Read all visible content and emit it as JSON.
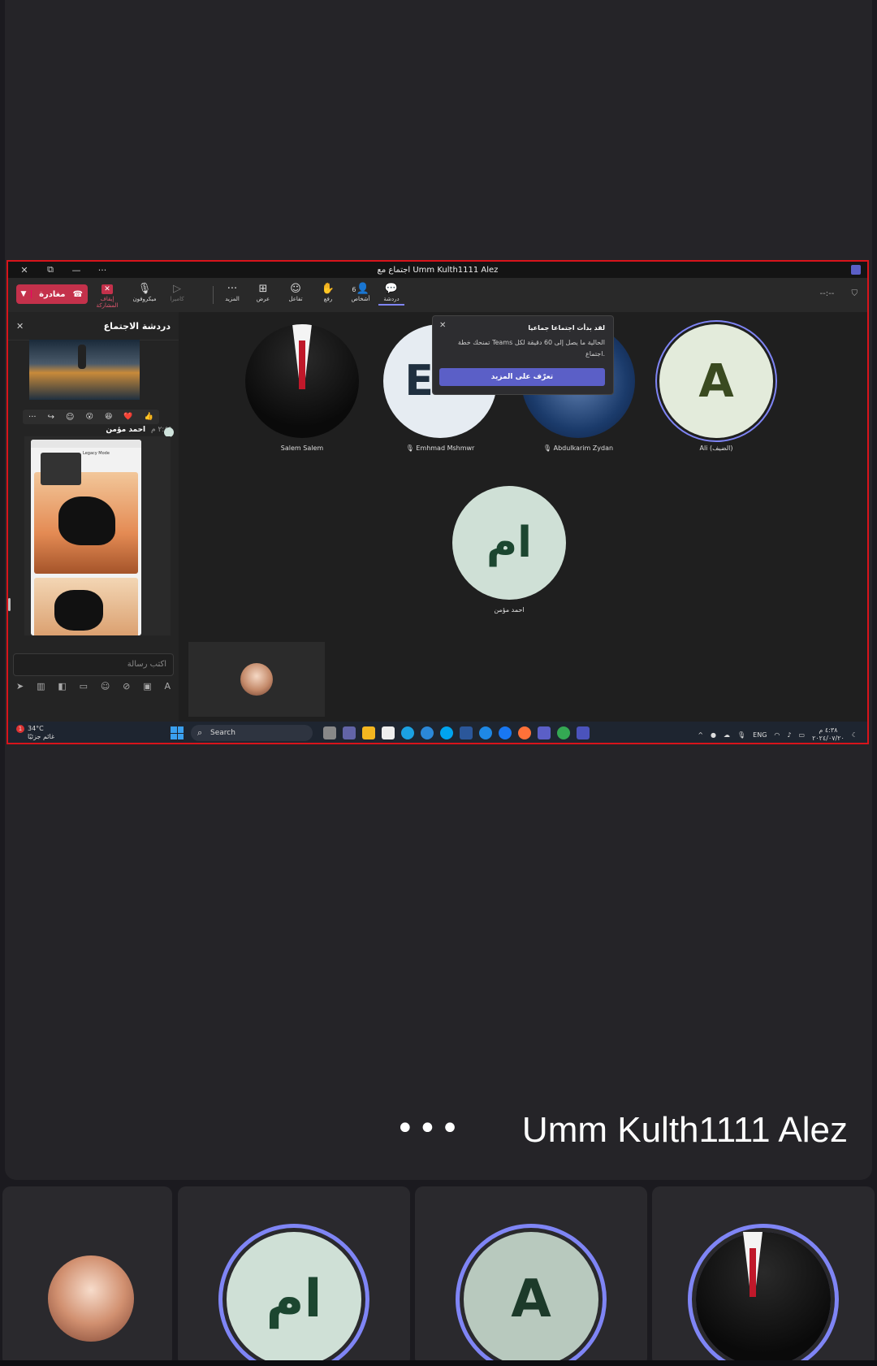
{
  "window": {
    "title": "اجتماع مع Umm Kulth1111 Alez",
    "controls": [
      "✕",
      "⧉",
      "—",
      "···"
    ]
  },
  "toolbar": {
    "leave_label": "مغادرة",
    "share_label": "إيقاف المشاركة",
    "mic_label": "ميكروفون",
    "camera_label": "كاميرا",
    "more_label": "المزيد",
    "view_label": "عرض",
    "react_label": "تفاعل",
    "raise_label": "رفع",
    "people_label": "أشخاص",
    "people_count": "6",
    "chat_label": "دردشة",
    "timer": "--:--"
  },
  "chat": {
    "title": "دردشة الاجتماع",
    "reactions": [
      "👍",
      "❤️",
      "😆",
      "😮"
    ],
    "sender": "احمد مؤمن",
    "time": "٢:٤٩ م",
    "legacy_mode": "Legacy Mode",
    "compose_placeholder": "اكتب رسالة"
  },
  "participants": [
    {
      "name": "Salem Salem"
    },
    {
      "name": "Emhmad Mshmwr",
      "initials": "EM"
    },
    {
      "name": "Abdulkarim Zydan"
    },
    {
      "name": "Ali (الضيف)",
      "initials": "A"
    },
    {
      "name": "احمد مؤمن",
      "initials": "ام"
    }
  ],
  "popup": {
    "title": "لقد بدأت اجتماعا جماعيا",
    "body": "تمنحك خطة Teams الحالية ما يصل إلى 60 دقيقة لكل اجتماع.",
    "button": "تعرّف على المزيد"
  },
  "taskbar": {
    "temp": "34°C",
    "weather": "غائم جزئيًا",
    "badge": "1",
    "search": "Search",
    "lang": "ENG",
    "clock": "٤:٣٨ م",
    "date": "٢٠٢٤/٠٧/٢٠"
  },
  "meeting": {
    "name": "Umm Kulth1111 Alez",
    "more": "•••"
  },
  "strip": [
    {
      "initials": ""
    },
    {
      "initials": "ام"
    },
    {
      "initials": "A"
    },
    {
      "initials": ""
    }
  ]
}
